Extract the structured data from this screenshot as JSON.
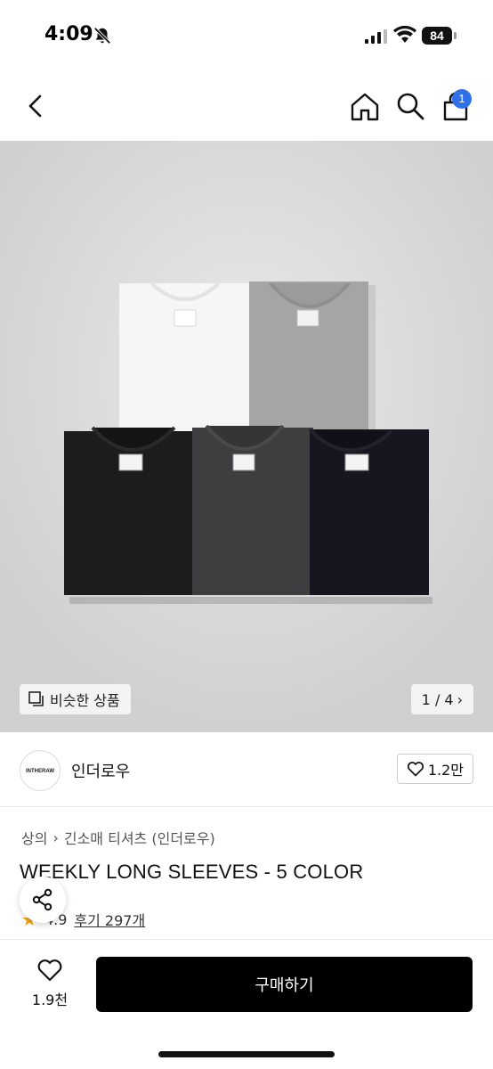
{
  "status_bar": {
    "time": "4:09",
    "battery": "84"
  },
  "header": {
    "cart_count": "1"
  },
  "gallery": {
    "similar_label": "비슷한 상품",
    "page_indicator": "1 / 4",
    "chevron": "›"
  },
  "brand": {
    "logo_text": "INTHERAW",
    "name": "인더로우",
    "like_count": "1.2만"
  },
  "product": {
    "breadcrumb": [
      "상의",
      "긴소매 티셔츠 (인더로우)"
    ],
    "breadcrumb_sep": "›",
    "title": "WEEKLY LONG SLEEVES - 5 COLOR",
    "rating": "4.9",
    "reviews": "후기 297개"
  },
  "bottom_bar": {
    "wish_count": "1.9천",
    "buy_label": "구매하기"
  },
  "colors": {
    "accent_badge": "#2f6fe8",
    "star": "#f2a20c",
    "buy_button": "#000000"
  }
}
